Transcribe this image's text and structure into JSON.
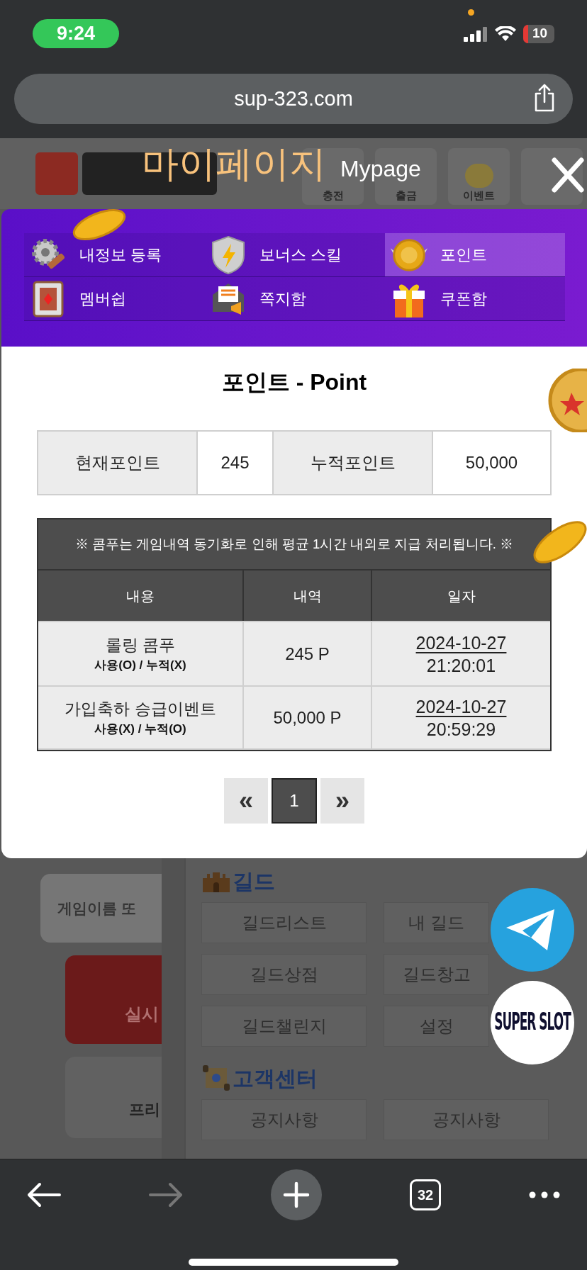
{
  "status_bar": {
    "time": "9:24",
    "battery": "10"
  },
  "browser": {
    "url": "sup-323.com",
    "tab_count": "32",
    "forward_disabled": true
  },
  "background_page": {
    "nav": [
      "충전",
      "출금",
      "이벤트"
    ],
    "search_placeholder": "게임이름 또",
    "red_button": "실시",
    "card_label": "프리",
    "sections": [
      {
        "title": "길드",
        "buttons": [
          "길드리스트",
          "내 길드",
          "길드상점",
          "길드창고",
          "길드챌린지",
          "설정"
        ]
      },
      {
        "title": "고객센터",
        "buttons": [
          "공지사항",
          "공지사항"
        ]
      }
    ],
    "floating_logo": "SUPER SLOT"
  },
  "modal": {
    "title": "마이페이지",
    "subtitle": "Mypage",
    "menu": [
      {
        "label": "내정보 등록",
        "selected": false
      },
      {
        "label": "보너스 스킬",
        "selected": false
      },
      {
        "label": "포인트",
        "selected": true
      },
      {
        "label": "멤버쉽",
        "selected": false
      },
      {
        "label": "쪽지함",
        "selected": false
      },
      {
        "label": "쿠폰함",
        "selected": false
      }
    ],
    "heading": "포인트 - Point",
    "summary": [
      {
        "label": "현재포인트",
        "value": "245"
      },
      {
        "label": "누적포인트",
        "value": "50,000"
      }
    ],
    "notice": "※ 콤푸는 게임내역 동기화로 인해 평균 1시간 내외로 지급 처리됩니다. ※",
    "columns": [
      "내용",
      "내역",
      "일자"
    ],
    "rows": [
      {
        "title": "롤링 콤푸",
        "note": "사용(O) / 누적(X)",
        "amount": "245 P",
        "date": "2024-10-27",
        "time": "21:20:01"
      },
      {
        "title": "가입축하 승급이벤트",
        "note": "사용(X) / 누적(O)",
        "amount": "50,000 P",
        "date": "2024-10-27",
        "time": "20:59:29"
      }
    ],
    "pagination": {
      "prev": "«",
      "pages": [
        {
          "label": "1",
          "selected": true
        }
      ],
      "next": "»"
    }
  }
}
